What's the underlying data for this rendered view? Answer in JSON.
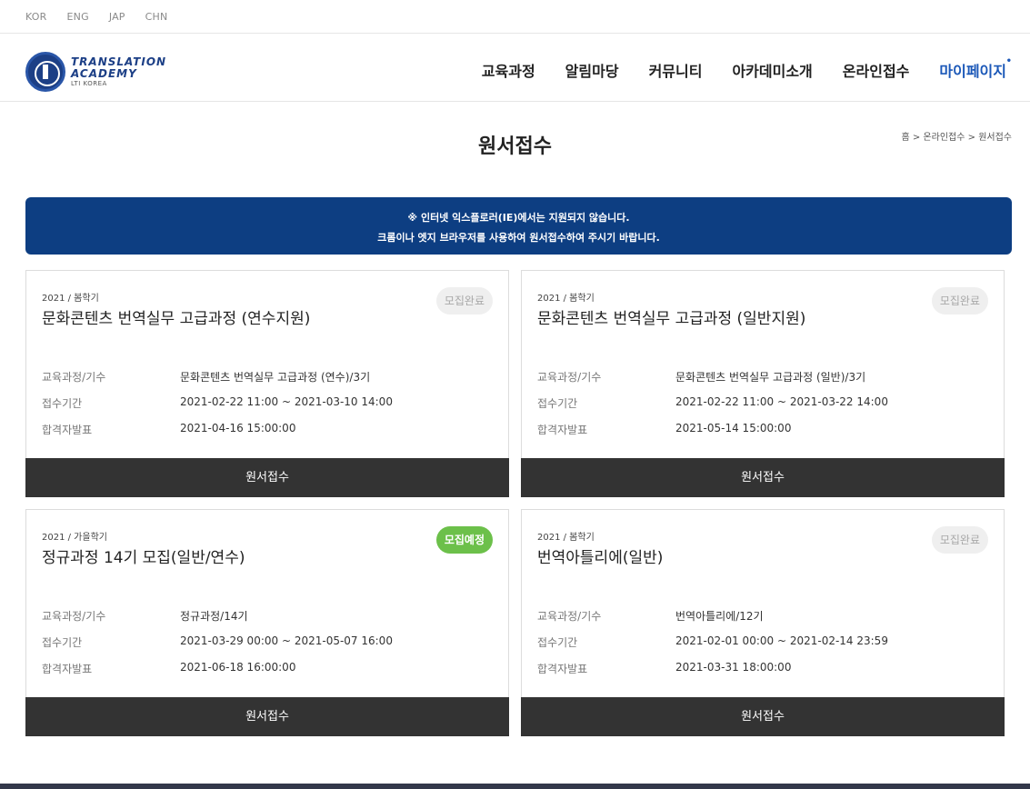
{
  "langs": [
    "KOR",
    "ENG",
    "JAP",
    "CHN"
  ],
  "logo": {
    "line1": "TRANSLATION",
    "line2": "ACADEMY",
    "line3": "LTI KOREA"
  },
  "nav": [
    {
      "label": "교육과정"
    },
    {
      "label": "알림마당"
    },
    {
      "label": "커뮤니티"
    },
    {
      "label": "아카데미소개"
    },
    {
      "label": "온라인접수"
    },
    {
      "label": "마이페이지"
    }
  ],
  "page": {
    "title": "원서접수"
  },
  "breadcrumb": {
    "home": "홈",
    "sep": ">",
    "level1": "온라인접수",
    "level2": "원서접수"
  },
  "notice": {
    "line1": "※ 인터넷 익스플로러(IE)에서는 지원되지 않습니다.",
    "line2": "크롬이나 엣지 브라우저를 사용하여 원서접수하여 주시기 바랍니다."
  },
  "labels": {
    "course": "교육과정/기수",
    "period": "접수기간",
    "announce": "합격자발표",
    "apply": "원서접수"
  },
  "cards": [
    {
      "meta": "2021 / 봄학기",
      "title": "문화콘텐츠 번역실무 고급과정 (연수지원)",
      "status": "모집완료",
      "course": "문화콘텐츠 번역실무 고급과정 (연수)/3기",
      "period": "2021-02-22 11:00 ~ 2021-03-10 14:00",
      "announce": "2021-04-16 15:00:00"
    },
    {
      "meta": "2021 / 봄학기",
      "title": "문화콘텐츠 번역실무 고급과정 (일반지원)",
      "status": "모집완료",
      "course": "문화콘텐츠 번역실무 고급과정 (일반)/3기",
      "period": "2021-02-22 11:00 ~ 2021-03-22 14:00",
      "announce": "2021-05-14 15:00:00"
    },
    {
      "meta": "2021 / 가을학기",
      "title": "정규과정 14기 모집(일반/연수)",
      "status": "모집예정",
      "course": "정규과정/14기",
      "period": "2021-03-29 00:00 ~ 2021-05-07 16:00",
      "announce": "2021-06-18 16:00:00"
    },
    {
      "meta": "2021 / 봄학기",
      "title": "번역아틀리에(일반)",
      "status": "모집완료",
      "course": "번역아틀리에/12기",
      "period": "2021-02-01 00:00 ~ 2021-02-14 23:59",
      "announce": "2021-03-31 18:00:00"
    }
  ],
  "colors": {
    "brand": "#0d3e82",
    "active_nav": "#1b58b8",
    "badge_open": "#6cc04a",
    "apply_button": "#333333"
  }
}
